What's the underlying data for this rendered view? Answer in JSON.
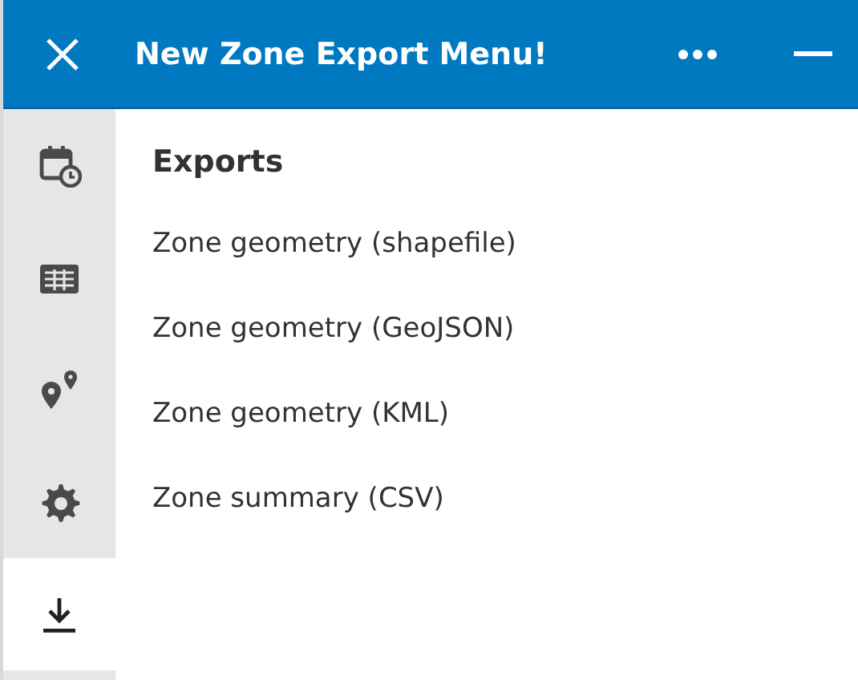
{
  "header": {
    "title": "New Zone Export Menu!"
  },
  "sidebar": {
    "items": [
      {
        "selected": false
      },
      {
        "selected": false
      },
      {
        "selected": false
      },
      {
        "selected": false
      },
      {
        "selected": true
      }
    ]
  },
  "panel": {
    "heading": "Exports",
    "items": [
      {
        "label": "Zone geometry (shapefile)"
      },
      {
        "label": "Zone geometry (GeoJSON)"
      },
      {
        "label": "Zone geometry (KML)"
      },
      {
        "label": "Zone summary (CSV)"
      }
    ]
  }
}
